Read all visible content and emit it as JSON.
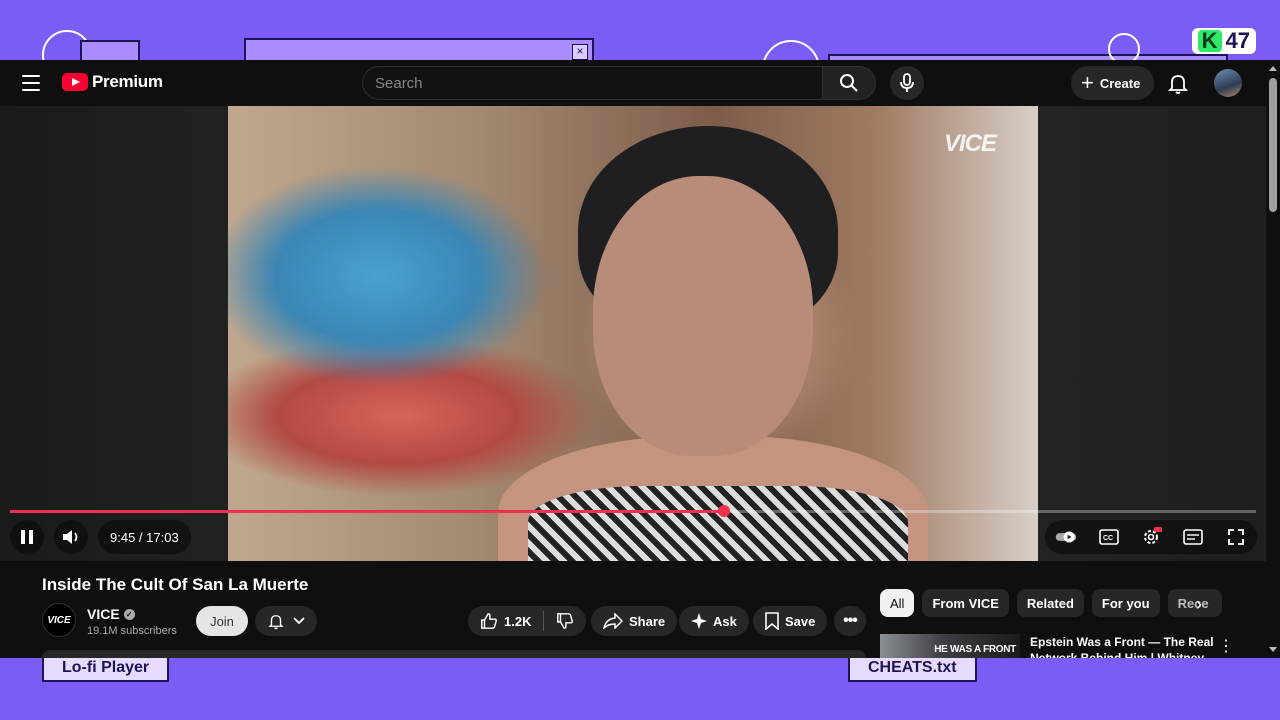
{
  "desktop": {
    "logo_text": "47",
    "logo_mark": "K",
    "taskbar": [
      {
        "label": "Lo-fi Player"
      },
      {
        "label": "CHEATS.txt"
      }
    ],
    "colors": {
      "background": "#7b5cf5",
      "window_border": "#1c1454"
    }
  },
  "youtube": {
    "brand": "Premium",
    "search": {
      "placeholder": "Search",
      "value": ""
    },
    "create_label": "Create",
    "icons": [
      "menu-icon",
      "youtube-logo-icon",
      "search-icon",
      "mic-icon",
      "plus-icon",
      "bell-icon"
    ],
    "player": {
      "watermark": "VICE",
      "time": "9:45 / 17:03",
      "progress": 0.573,
      "accent": "#f0324f"
    },
    "video": {
      "title": "Inside The Cult Of San La Muerte",
      "channel": "VICE",
      "channel_avatar_text": "VICE",
      "subscribers": "19.1M subscribers",
      "join_label": "Join",
      "likes": "1.2K",
      "share_label": "Share",
      "ask_label": "Ask",
      "save_label": "Save"
    },
    "chips": [
      "All",
      "From VICE",
      "Related",
      "For you",
      "Rece"
    ],
    "recommendation": {
      "thumb_text": "HE WAS A FRONT",
      "title": "Epstein Was a Front — The Real Network Behind Him | Whitney"
    }
  }
}
